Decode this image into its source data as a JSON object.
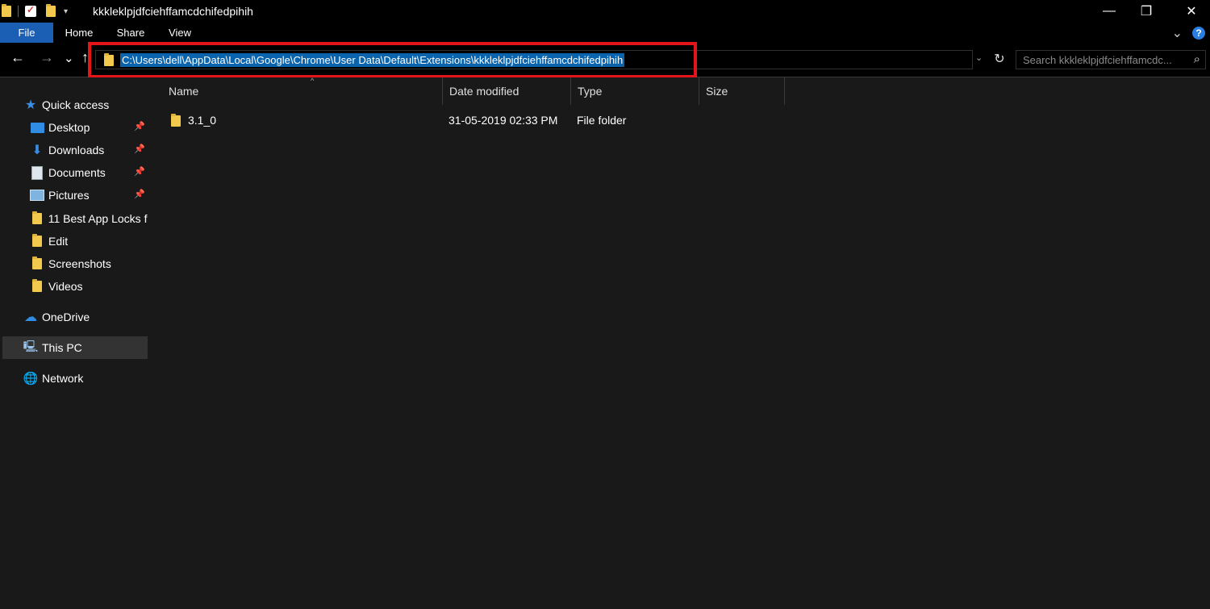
{
  "window": {
    "title": "kkkleklpjdfciehffamcdchifedpihih",
    "minimize_glyph": "—",
    "restore_glyph": "❐",
    "close_glyph": "✕"
  },
  "ribbon": {
    "tabs": [
      "File",
      "Home",
      "Share",
      "View"
    ],
    "expand_glyph": "⌄",
    "help_glyph": "?"
  },
  "nav": {
    "back_glyph": "←",
    "forward_glyph": "→",
    "recent_glyph": "⌄",
    "up_glyph": "↑",
    "address": "C:\\Users\\dell\\AppData\\Local\\Google\\Chrome\\User Data\\Default\\Extensions\\kkkleklpjdfciehffamcdchifedpihih",
    "address_drop_glyph": "⌄",
    "refresh_glyph": "↻",
    "search_placeholder": "Search kkkleklpjdfciehffamcdc...",
    "search_glyph": "⌕"
  },
  "sidebar": {
    "quick_access": "Quick access",
    "pinned": [
      {
        "label": "Desktop",
        "icon": "desktop-icon"
      },
      {
        "label": "Downloads",
        "icon": "download-icon"
      },
      {
        "label": "Documents",
        "icon": "document-icon"
      },
      {
        "label": "Pictures",
        "icon": "pictures-icon"
      }
    ],
    "folders": [
      "11 Best App Locks f",
      "Edit",
      "Screenshots",
      "Videos"
    ],
    "onedrive": "OneDrive",
    "this_pc": "This PC",
    "network": "Network",
    "pin_glyph": "📌"
  },
  "columns": [
    "Name",
    "Date modified",
    "Type",
    "Size"
  ],
  "sort_glyph": "^",
  "files": [
    {
      "name": "3.1_0",
      "date": "31-05-2019 02:33 PM",
      "type": "File folder",
      "size": ""
    }
  ],
  "colors": {
    "accent": "#0a64ad",
    "highlight_border": "#e3141a",
    "folder": "#f2c94c"
  }
}
